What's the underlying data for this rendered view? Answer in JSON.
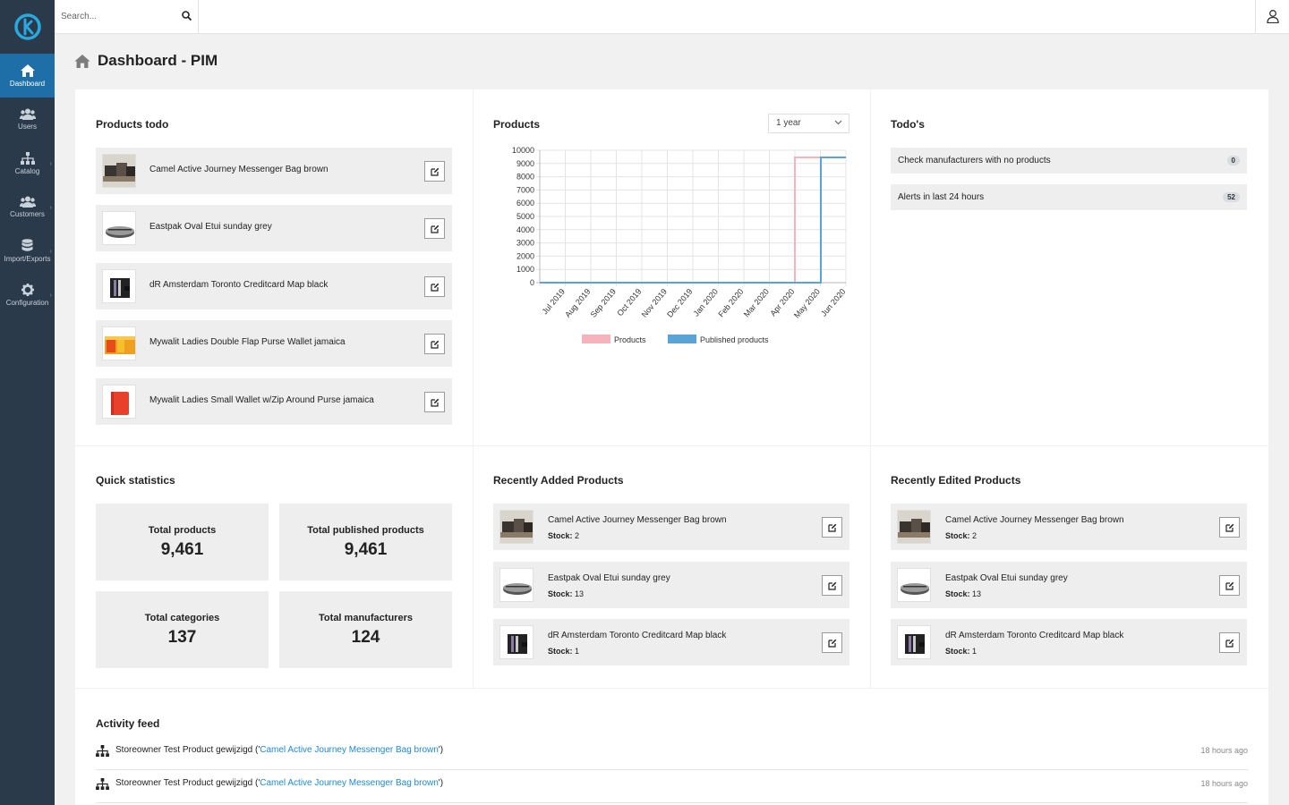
{
  "search": {
    "placeholder": "Search..."
  },
  "sidebar": {
    "items": [
      {
        "label": "Dashboard",
        "icon": "home-icon",
        "active": true
      },
      {
        "label": "Users",
        "icon": "users-icon"
      },
      {
        "label": "Catalog",
        "icon": "sitemap-icon"
      },
      {
        "label": "Customers",
        "icon": "users-icon"
      },
      {
        "label": "Import/Exports",
        "icon": "database-icon"
      },
      {
        "label": "Configuration",
        "icon": "gear-icon"
      }
    ]
  },
  "page": {
    "title": "Dashboard - PIM"
  },
  "products_todo": {
    "title": "Products todo",
    "items": [
      {
        "name": "Camel Active Journey Messenger Bag brown"
      },
      {
        "name": "Eastpak Oval Etui sunday grey"
      },
      {
        "name": "dR Amsterdam Toronto Creditcard Map black"
      },
      {
        "name": "Mywalit Ladies Double Flap Purse Wallet jamaica"
      },
      {
        "name": "Mywalit Ladies Small Wallet w/Zip Around Purse jamaica"
      }
    ]
  },
  "products_chart": {
    "title": "Products",
    "range_select": "1 year"
  },
  "chart_data": {
    "type": "line",
    "title": "",
    "x": [
      "Jul 2019",
      "Aug 2019",
      "Sep 2019",
      "Oct 2019",
      "Nov 2019",
      "Dec 2019",
      "Jan 2020",
      "Feb 2020",
      "Mar 2020",
      "Apr 2020",
      "May 2020",
      "Jun 2020"
    ],
    "series": [
      {
        "name": "Products",
        "color": "#f7b3bc",
        "values": [
          0,
          0,
          0,
          0,
          0,
          0,
          0,
          0,
          0,
          0,
          9461,
          9461
        ]
      },
      {
        "name": "Published products",
        "color": "#5aa3d6",
        "values": [
          0,
          0,
          0,
          0,
          0,
          0,
          0,
          0,
          0,
          0,
          0,
          9461
        ]
      }
    ],
    "yticks": [
      0,
      1000,
      2000,
      3000,
      4000,
      5000,
      6000,
      7000,
      8000,
      9000,
      10000
    ],
    "ylim": [
      0,
      10000
    ],
    "grid": true,
    "legend": "bottom"
  },
  "todos": {
    "title": "Todo's",
    "items": [
      {
        "label": "Check manufacturers with no products",
        "count": "0"
      },
      {
        "label": "Alerts in last 24 hours",
        "count": "52"
      }
    ]
  },
  "quick_stats": {
    "title": "Quick statistics",
    "items": [
      {
        "label": "Total products",
        "value": "9,461"
      },
      {
        "label": "Total published products",
        "value": "9,461"
      },
      {
        "label": "Total categories",
        "value": "137"
      },
      {
        "label": "Total manufacturers",
        "value": "124"
      }
    ]
  },
  "recently_added": {
    "title": "Recently Added Products",
    "stock_label": "Stock:",
    "items": [
      {
        "name": "Camel Active Journey Messenger Bag brown",
        "stock": "2"
      },
      {
        "name": "Eastpak Oval Etui sunday grey",
        "stock": "13"
      },
      {
        "name": "dR Amsterdam Toronto Creditcard Map black",
        "stock": "1"
      }
    ]
  },
  "recently_edited": {
    "title": "Recently Edited Products",
    "stock_label": "Stock:",
    "items": [
      {
        "name": "Camel Active Journey Messenger Bag brown",
        "stock": "2"
      },
      {
        "name": "Eastpak Oval Etui sunday grey",
        "stock": "13"
      },
      {
        "name": "dR Amsterdam Toronto Creditcard Map black",
        "stock": "1"
      }
    ]
  },
  "activity_feed": {
    "title": "Activity feed",
    "items": [
      {
        "text": "Storeowner Test Product gewijzigd ('",
        "link": "Camel Active Journey Messenger Bag brown",
        "suffix": "')",
        "time": "18 hours ago"
      },
      {
        "text": "Storeowner Test Product gewijzigd ('",
        "link": "Camel Active Journey Messenger Bag brown",
        "suffix": "')",
        "time": "18 hours ago"
      }
    ]
  }
}
